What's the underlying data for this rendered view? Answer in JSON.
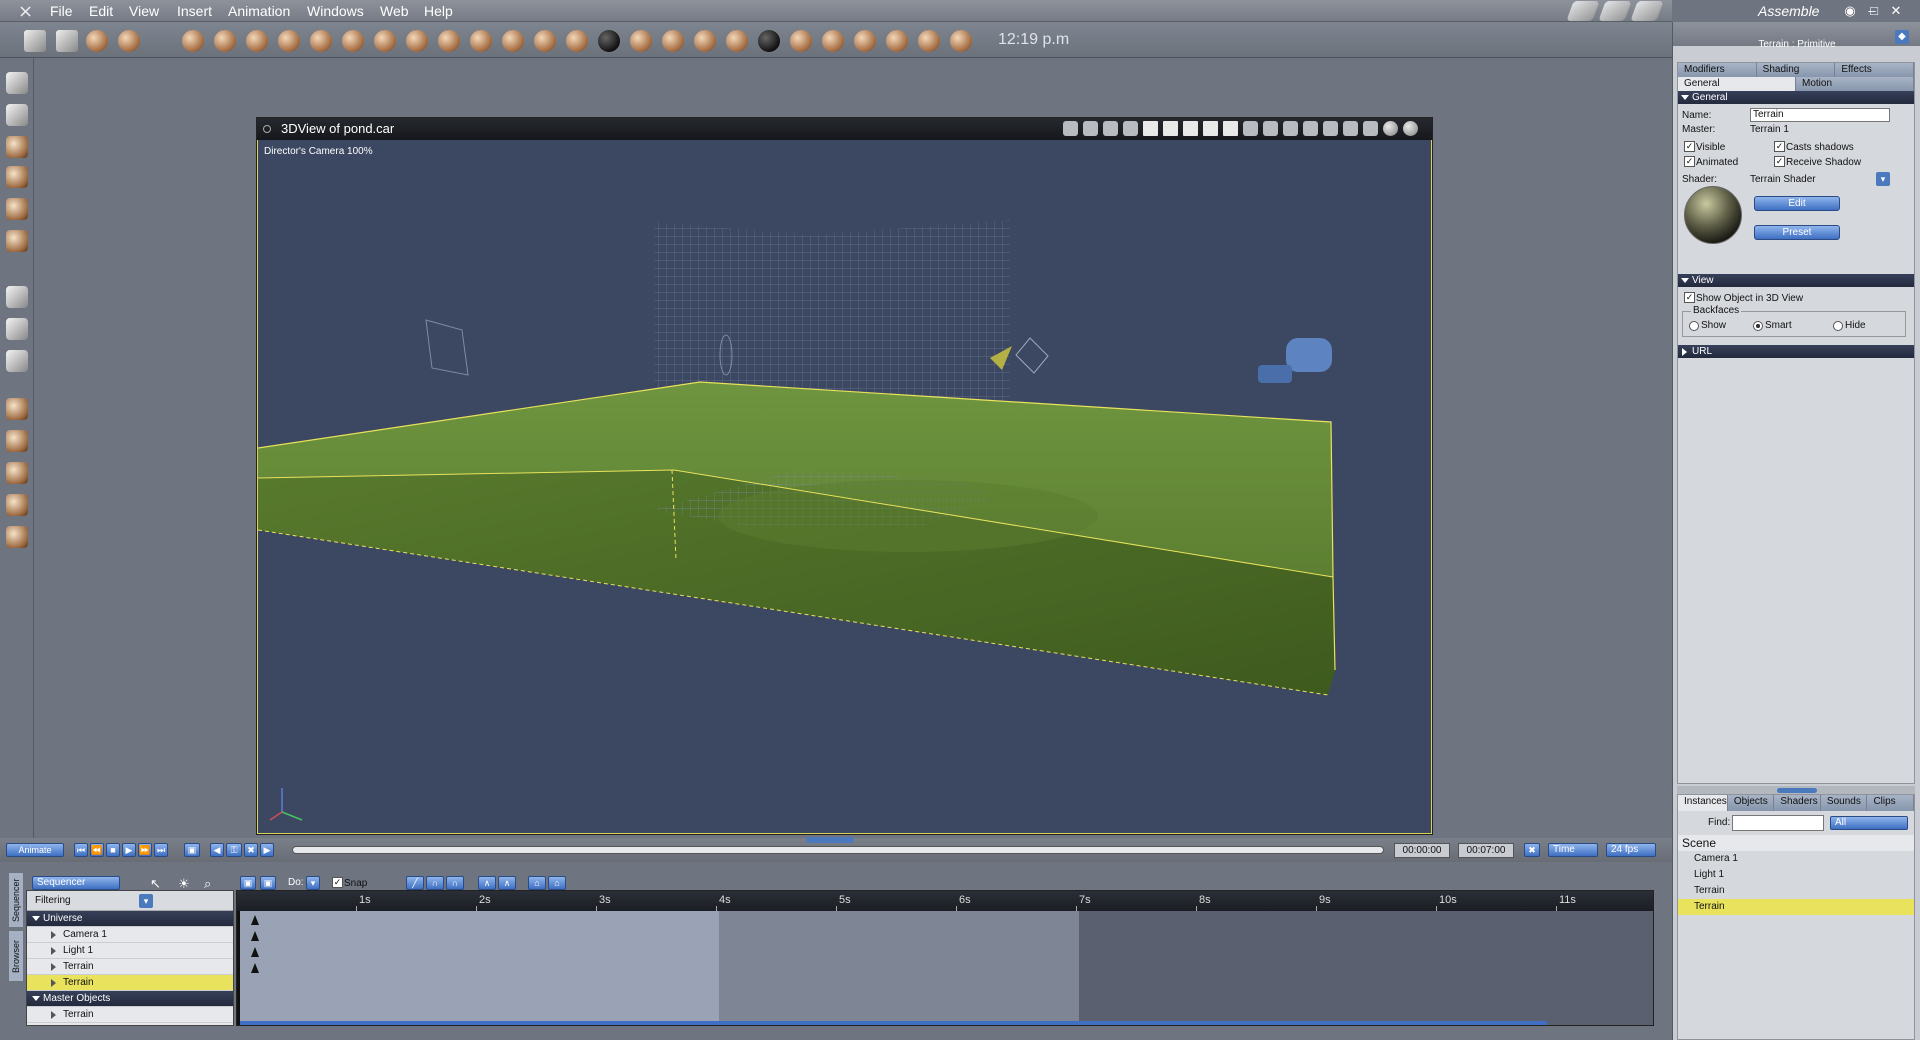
{
  "menu": {
    "items": [
      "File",
      "Edit",
      "View",
      "Insert",
      "Animation",
      "Windows",
      "Web",
      "Help"
    ],
    "room": "Assemble"
  },
  "toolbar": {
    "clock": "12:19 p.m"
  },
  "view3d": {
    "title": "3DView of pond.car",
    "camera_label": "Director's Camera 100%"
  },
  "properties": {
    "title": "Terrain : Primitive",
    "tabs_row1": [
      "Modifiers",
      "Shading",
      "Effects"
    ],
    "tabs_row2": [
      "General",
      "Motion"
    ],
    "general_section": "General",
    "name_label": "Name:",
    "name_value": "Terrain",
    "master_label": "Master:",
    "master_value": "Terrain 1",
    "visible": "Visible",
    "casts_shadows": "Casts shadows",
    "animated": "Animated",
    "receive_shadow": "Receive Shadow",
    "shader_label": "Shader:",
    "shader_value": "Terrain Shader",
    "edit_btn": "Edit",
    "preset_btn": "Preset",
    "view_section": "View",
    "show_in_3d": "Show Object in 3D View",
    "backfaces": "Backfaces",
    "bf_show": "Show",
    "bf_smart": "Smart",
    "bf_hide": "Hide",
    "url_section": "URL"
  },
  "browser": {
    "tabs": [
      "Instances",
      "Objects",
      "Shaders",
      "Sounds",
      "Clips"
    ],
    "find_label": "Find:",
    "find_value": "",
    "filter_value": "All",
    "scene_header": "Scene",
    "items": [
      "Camera 1",
      "Light 1",
      "Terrain",
      "Terrain"
    ]
  },
  "transport": {
    "animate_btn": "Animate",
    "time_current": "00:00:00",
    "time_end": "00:07:00",
    "mode": "Time",
    "fps": "24 fps"
  },
  "sequencer": {
    "mode_select": "Sequencer",
    "do_label": "Do:",
    "snap_label": "Snap",
    "filtering": "Filtering",
    "side_tabs": [
      "Sequencer",
      "Browser"
    ],
    "tree": [
      {
        "label": "Universe",
        "type": "grp"
      },
      {
        "label": "Camera 1",
        "type": "child"
      },
      {
        "label": "Light 1",
        "type": "child"
      },
      {
        "label": "Terrain",
        "type": "child"
      },
      {
        "label": "Terrain",
        "type": "child",
        "hl": true
      },
      {
        "label": "Master Objects",
        "type": "grp"
      },
      {
        "label": "Terrain",
        "type": "child"
      }
    ],
    "ruler": [
      "1s",
      "2s",
      "3s",
      "4s",
      "5s",
      "6s",
      "7s",
      "8s",
      "9s",
      "10s",
      "11s"
    ]
  },
  "colors": {
    "viewport_bg": "#3c4761",
    "terrain": "#6a8a38",
    "selection": "#e8e25c",
    "accent_blue": "#3e6fc2"
  }
}
